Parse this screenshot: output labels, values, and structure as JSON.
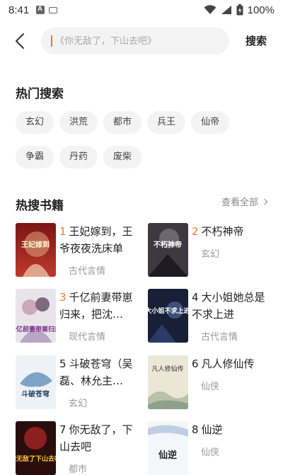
{
  "status_bar": {
    "time": "8:41",
    "battery": "100%"
  },
  "header": {
    "search_placeholder": "《你无敌了，下山去吧》",
    "search_button": "搜索"
  },
  "hot_search": {
    "title": "热门搜索",
    "tags": [
      "玄幻",
      "洪荒",
      "都市",
      "兵王",
      "仙帝",
      "争霸",
      "丹药",
      "废柴"
    ]
  },
  "hot_books": {
    "title": "热搜书籍",
    "view_all": "查看全部",
    "books": [
      {
        "rank": "1",
        "title": "王妃嫁到，王爷夜夜洗床单",
        "category": "古代言情"
      },
      {
        "rank": "2",
        "title": "不朽神帝",
        "category": "玄幻"
      },
      {
        "rank": "3",
        "title": "千亿前妻带崽归来，把沈…",
        "category": "现代言情"
      },
      {
        "rank": "4",
        "title": "大小姐她总是不求上进",
        "category": "古代言情"
      },
      {
        "rank": "5",
        "title": "斗破苍穹（吴磊、林允主…",
        "category": "玄幻"
      },
      {
        "rank": "6",
        "title": "凡人修仙传",
        "category": "仙侠"
      },
      {
        "rank": "7",
        "title": "你无敌了，下山去吧",
        "category": "都市"
      },
      {
        "rank": "8",
        "title": "仙逆",
        "category": "仙侠"
      }
    ],
    "cover_texts": [
      "王妃嫁到",
      "不朽神帝",
      "千亿前妻带崽归来",
      "大小姐不求上进",
      "斗破苍穹",
      "凡人修仙传",
      "你无敌了下山去吧",
      "仙逆"
    ]
  },
  "colors": {
    "accent": "#f07a2a",
    "tag_bg": "#f3f3f3",
    "muted": "#999999"
  }
}
